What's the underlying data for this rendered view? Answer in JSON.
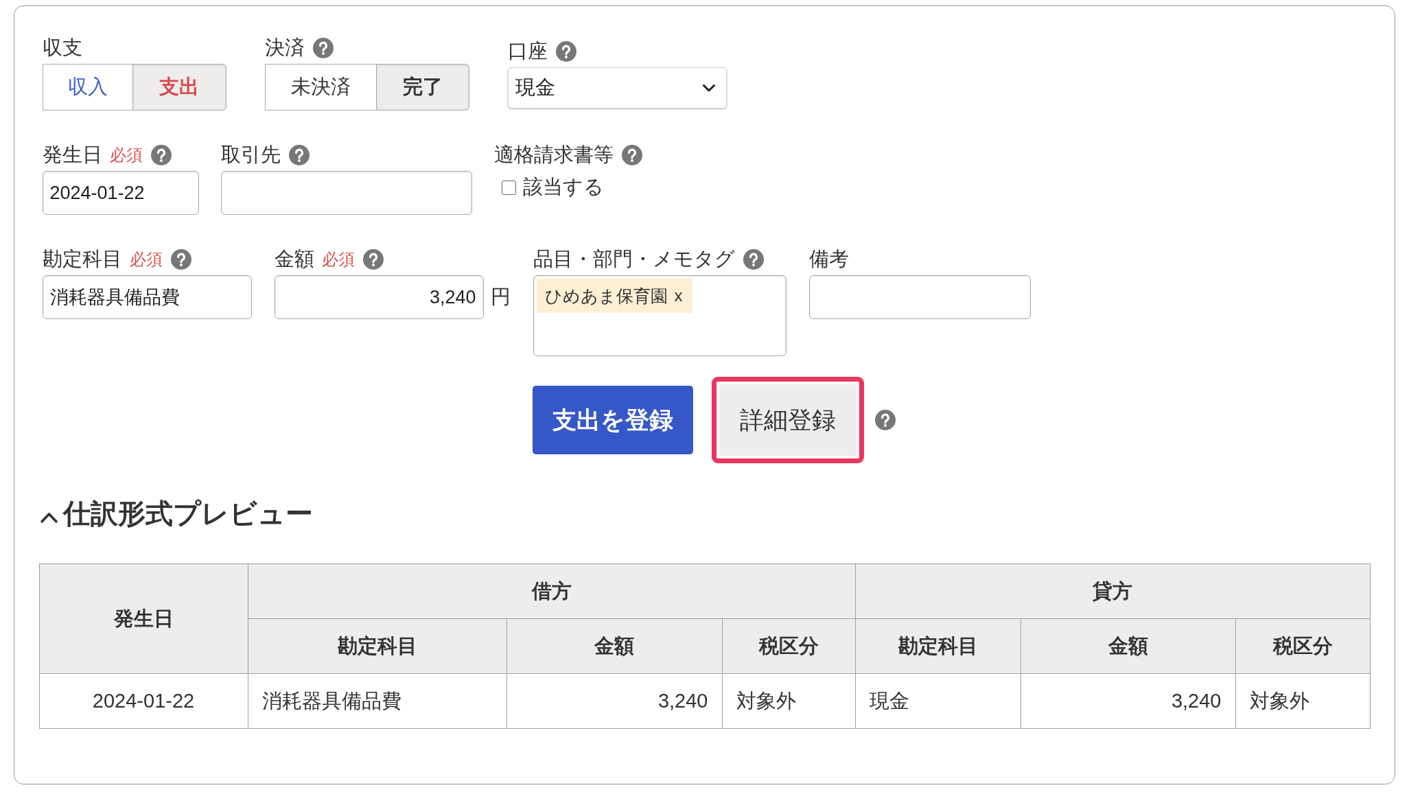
{
  "income_expense": {
    "label": "収支",
    "help": false,
    "options": [
      {
        "label": "収入",
        "selected": false,
        "color": "#3d5fc4"
      },
      {
        "label": "支出",
        "selected": true,
        "color": "#d9484d"
      }
    ]
  },
  "settlement": {
    "label": "決済",
    "help": true,
    "options": [
      {
        "label": "未決済",
        "selected": false
      },
      {
        "label": "完了",
        "selected": true
      }
    ]
  },
  "account": {
    "label": "口座",
    "help": true,
    "value": "現金"
  },
  "issue_date": {
    "label": "発生日",
    "required": "必須",
    "help": true,
    "value": "2024-01-22"
  },
  "partner": {
    "label": "取引先",
    "help": true
  },
  "qualified_invoice": {
    "label": "適格請求書等",
    "help": true,
    "checkbox": {
      "label": "該当する",
      "checked": false
    }
  },
  "account_item": {
    "label": "勘定科目",
    "required": "必須",
    "help": true,
    "value": "消耗器具備品費"
  },
  "amount": {
    "label": "金額",
    "required": "必須",
    "help": true,
    "value": "3,240",
    "unit": "円"
  },
  "tags": {
    "label": "品目・部門・メモタグ",
    "help": true,
    "items": [
      {
        "label": "ひめあま保育園",
        "remove": "x"
      }
    ]
  },
  "memo": {
    "label": "備考",
    "help": false
  },
  "actions": {
    "help": true,
    "buttons": [
      {
        "label": "支出を登録",
        "kind": "primary",
        "focused": false
      },
      {
        "label": "詳細登録",
        "kind": "secondary",
        "focused": true
      }
    ]
  },
  "preview": {
    "title": "仕訳形式プレビュー",
    "expanded": true,
    "table": {
      "header_rows": [
        [
          {
            "label": "発生日",
            "rowspan": 2,
            "kind": "date"
          },
          {
            "label": "借方",
            "colspan": 3
          },
          {
            "label": "貸方",
            "colspan": 3
          }
        ],
        [
          {
            "label": "勘定科目",
            "kind": "text"
          },
          {
            "label": "金額",
            "kind": "amount"
          },
          {
            "label": "税区分",
            "kind": "text"
          },
          {
            "label": "勘定科目",
            "kind": "text"
          },
          {
            "label": "金額",
            "kind": "amount"
          },
          {
            "label": "税区分",
            "kind": "text"
          }
        ]
      ],
      "rows": [
        [
          "2024-01-22",
          "消耗器具備品費",
          "3,240",
          "対象外",
          "現金",
          "3,240",
          "対象外"
        ]
      ]
    }
  }
}
